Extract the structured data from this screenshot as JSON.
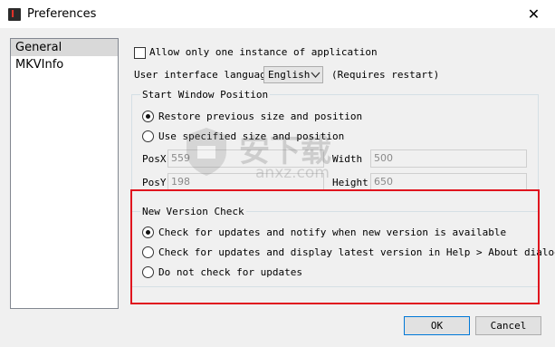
{
  "window": {
    "title": "Preferences",
    "app_icon_letter": "I",
    "close_glyph": "✕"
  },
  "sidebar": {
    "items": [
      {
        "label": "General",
        "selected": true
      },
      {
        "label": "MKVInfo",
        "selected": false
      }
    ]
  },
  "general": {
    "single_instance": {
      "label": "Allow only one instance of application",
      "checked": false
    },
    "ui_language": {
      "label": "User interface language",
      "value": "English",
      "note": "(Requires restart)"
    },
    "start_position": {
      "title": "Start Window Position",
      "options": [
        {
          "label": "Restore previous size and position",
          "checked": true
        },
        {
          "label": "Use specified size and position",
          "checked": false
        }
      ],
      "pos_x": {
        "label": "PosX",
        "value": "559"
      },
      "pos_y": {
        "label": "PosY",
        "value": "198"
      },
      "width": {
        "label": "Width",
        "value": "500"
      },
      "height": {
        "label": "Height",
        "value": "650"
      }
    },
    "version_check": {
      "title": "New Version Check",
      "options": [
        {
          "label": "Check for updates and notify when new version is available",
          "checked": true
        },
        {
          "label": "Check for updates and display latest version in Help > About dialog",
          "checked": false
        },
        {
          "label": "Do not check for updates",
          "checked": false
        }
      ]
    }
  },
  "buttons": {
    "ok": "OK",
    "cancel": "Cancel"
  },
  "watermark": {
    "text": "安下载",
    "subtext": "anxz.com"
  },
  "colors": {
    "highlight_border": "#e0141e",
    "ok_border": "#0078d7"
  }
}
